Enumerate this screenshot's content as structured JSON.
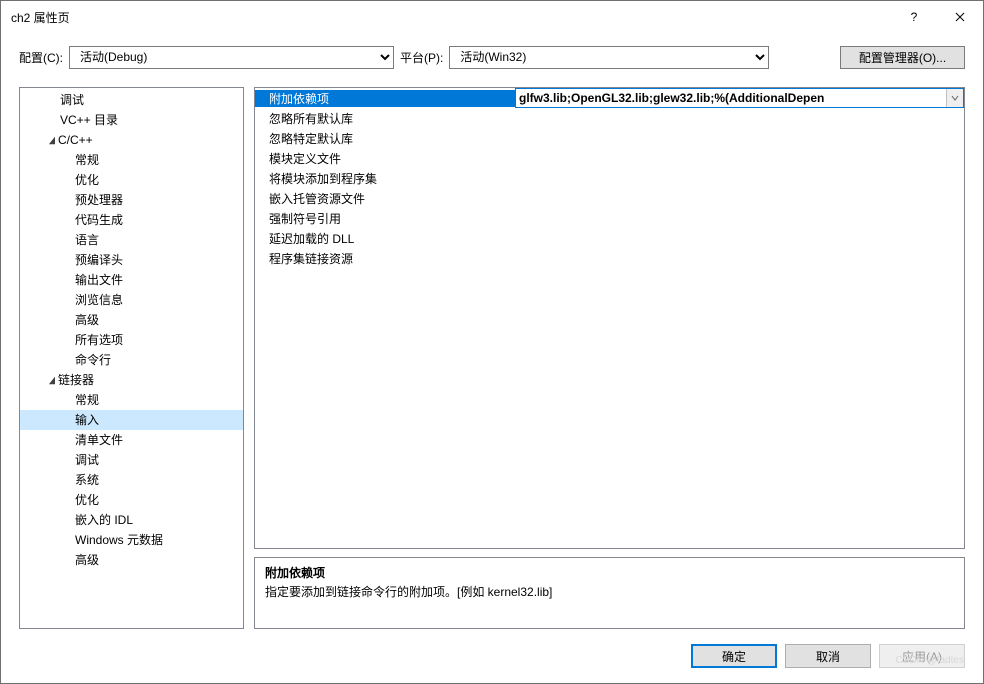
{
  "window": {
    "title": "ch2 属性页"
  },
  "toolbar": {
    "config_label": "配置(C):",
    "config_value": "活动(Debug)",
    "platform_label": "平台(P):",
    "platform_value": "活动(Win32)",
    "config_manager": "配置管理器(O)..."
  },
  "tree": [
    {
      "label": "调试",
      "indent": "ind1"
    },
    {
      "label": "VC++ 目录",
      "indent": "ind1"
    },
    {
      "label": "C/C++",
      "indent": "ind1e",
      "expander": "▲"
    },
    {
      "label": "常规",
      "indent": "ind2"
    },
    {
      "label": "优化",
      "indent": "ind2"
    },
    {
      "label": "预处理器",
      "indent": "ind2"
    },
    {
      "label": "代码生成",
      "indent": "ind2"
    },
    {
      "label": "语言",
      "indent": "ind2"
    },
    {
      "label": "预编译头",
      "indent": "ind2"
    },
    {
      "label": "输出文件",
      "indent": "ind2"
    },
    {
      "label": "浏览信息",
      "indent": "ind2"
    },
    {
      "label": "高级",
      "indent": "ind2"
    },
    {
      "label": "所有选项",
      "indent": "ind2"
    },
    {
      "label": "命令行",
      "indent": "ind2"
    },
    {
      "label": "链接器",
      "indent": "ind1e",
      "expander": "▲"
    },
    {
      "label": "常规",
      "indent": "ind2"
    },
    {
      "label": "输入",
      "indent": "ind2",
      "selected": true
    },
    {
      "label": "清单文件",
      "indent": "ind2"
    },
    {
      "label": "调试",
      "indent": "ind2"
    },
    {
      "label": "系统",
      "indent": "ind2"
    },
    {
      "label": "优化",
      "indent": "ind2"
    },
    {
      "label": "嵌入的 IDL",
      "indent": "ind2"
    },
    {
      "label": "Windows 元数据",
      "indent": "ind2"
    },
    {
      "label": "高级",
      "indent": "ind2"
    }
  ],
  "grid": [
    {
      "key": "附加依赖项",
      "val": "glfw3.lib;OpenGL32.lib;glew32.lib;%(AdditionalDepen",
      "selected": true
    },
    {
      "key": "忽略所有默认库",
      "val": ""
    },
    {
      "key": "忽略特定默认库",
      "val": ""
    },
    {
      "key": "模块定义文件",
      "val": ""
    },
    {
      "key": "将模块添加到程序集",
      "val": ""
    },
    {
      "key": "嵌入托管资源文件",
      "val": ""
    },
    {
      "key": "强制符号引用",
      "val": ""
    },
    {
      "key": "延迟加载的 DLL",
      "val": ""
    },
    {
      "key": "程序集链接资源",
      "val": ""
    }
  ],
  "description": {
    "heading": "附加依赖项",
    "body": "指定要添加到链接命令行的附加项。[例如 kernel32.lib]"
  },
  "footer": {
    "ok": "确定",
    "cancel": "取消",
    "apply": "应用(A)"
  },
  "watermark": "CSDN @fadtes"
}
